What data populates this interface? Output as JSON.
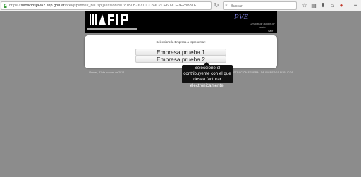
{
  "browser": {
    "url_prefix": "https://",
    "url_host": "serviciosjava2.afip.gob.ar",
    "url_path": "/rcel/jsp/index_bis.jsp;jsessionid=781B0B76711CC59C7CE609CE7F28B31E",
    "search_placeholder": "Buscar"
  },
  "header": {
    "app_name": "PVE",
    "app_subtitle": "Gestión de puntos de venta",
    "salir_label": "Salir"
  },
  "main": {
    "title": "Seleccione la Empresa a representar:",
    "empresas": [
      "Empresa prueba 1",
      "Empresa prueba 2"
    ]
  },
  "footer": {
    "date": "Viernes, 31 de octubre de 2014",
    "org": "ADMINISTRACIÓN FEDERAL DE INGRESOS PÚBLICOS"
  },
  "tooltip": {
    "text": "Seleccione el contribuyente con el que desea facturar electrónicamente."
  }
}
